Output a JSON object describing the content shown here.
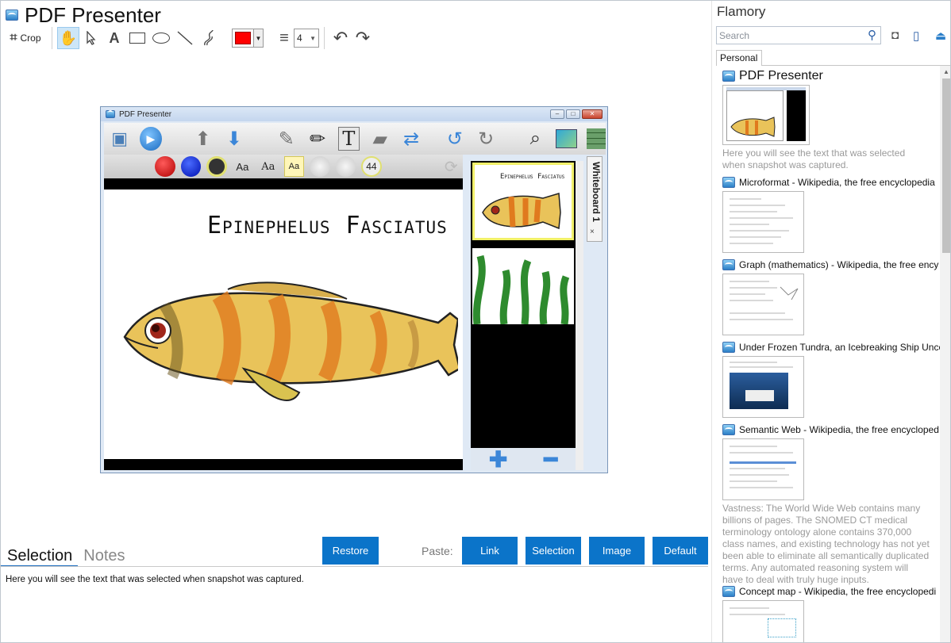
{
  "app": {
    "title": "PDF Presenter",
    "toolbar": {
      "crop_label": "Crop",
      "line_width": "4",
      "pen_color": "#ff0000"
    }
  },
  "preview": {
    "window_title": "PDF Presenter",
    "slide_title": "Epinephelus Fasciatus",
    "font_size_badge": "44",
    "aa_labels": [
      "Aa",
      "Aa",
      "Aa"
    ],
    "side_tab": "Whiteboard 1",
    "side_close": "×",
    "thumb_title": "Epinephelus Fasciatus"
  },
  "bottom": {
    "tabs": [
      "Selection",
      "Notes"
    ],
    "restore": "Restore",
    "paste_label": "Paste:",
    "paste_buttons": [
      "Link",
      "Selection",
      "Image",
      "Default"
    ],
    "selection_text": "Here you will see the text that was selected when snapshot was captured."
  },
  "flamory": {
    "title": "Flamory",
    "search_placeholder": "Search",
    "tab": "Personal",
    "entries": [
      {
        "title": "PDF Presenter",
        "desc": "Here you will see the text that was selected when snapshot was captured."
      },
      {
        "title": "Microformat - Wikipedia, the free encyclopedia"
      },
      {
        "title": "Graph (mathematics) - Wikipedia, the free ency"
      },
      {
        "title": "Under Frozen Tundra, an Icebreaking Ship Unco"
      },
      {
        "title": "Semantic Web - Wikipedia, the free encycloped",
        "desc": "Vastness: The World Wide Web contains many billions of pages. The SNOMED CT medical terminology ontology alone contains 370,000 class names, and existing technology has not yet been able to eliminate all semantically duplicated terms. Any automated reasoning system will have to deal with truly huge inputs."
      },
      {
        "title": "Concept map - Wikipedia, the free encyclopedi"
      }
    ]
  }
}
